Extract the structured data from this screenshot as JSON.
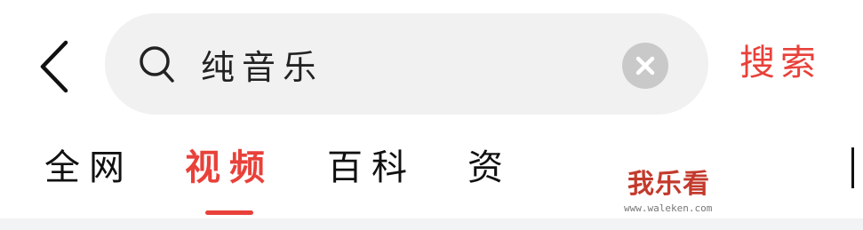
{
  "header": {
    "back_icon": "chevron-left-icon",
    "search": {
      "icon": "search-icon",
      "value": "纯音乐",
      "placeholder": "",
      "clear_icon": "clear-circle-icon"
    },
    "search_button_label": "搜索"
  },
  "tabs": {
    "items": [
      {
        "label": "全网",
        "active": false
      },
      {
        "label": "视频",
        "active": true
      },
      {
        "label": "百科",
        "active": false
      },
      {
        "label": "资",
        "active": false
      }
    ]
  },
  "watermark": {
    "logo_text": "我乐看",
    "url_text": "www.waleken.com"
  },
  "colors": {
    "accent": "#e8413a",
    "text": "#111111",
    "search_bg": "#f1f1f1",
    "clear_bg": "#c9c9c9",
    "divider": "#f2f3f5"
  }
}
